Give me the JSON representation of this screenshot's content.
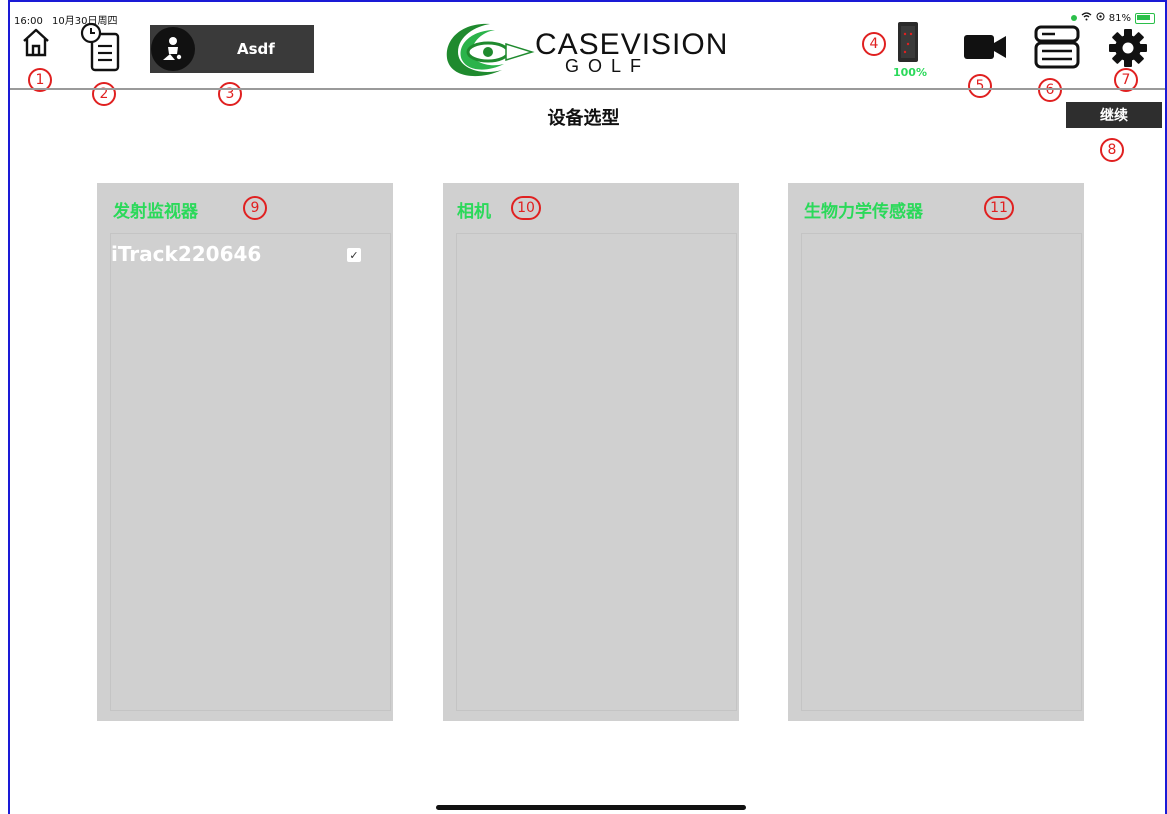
{
  "status_bar": {
    "time": "16:00",
    "date": "10月30日周四",
    "battery_percent": "81%"
  },
  "toolbar": {
    "user_name": "Asdf",
    "logo_main": "CASEVISION",
    "logo_sub": "GOLF",
    "device_battery": "100%",
    "continue_label": "继续"
  },
  "page": {
    "title": "设备选型"
  },
  "panels": [
    {
      "title": "发射监视器",
      "devices": [
        {
          "name": "iTrack220646",
          "checked": true
        }
      ]
    },
    {
      "title": "相机",
      "devices": []
    },
    {
      "title": "生物力学传感器",
      "devices": []
    }
  ],
  "annotations": [
    "1",
    "2",
    "3",
    "4",
    "5",
    "6",
    "7",
    "8",
    "9",
    "10",
    "11"
  ],
  "colors": {
    "accent_green": "#2bd95a",
    "annotation_red": "#e02020",
    "panel_gray": "#d0d0d0",
    "dark_button": "#2e2e2e"
  },
  "icons": {
    "home": "home-icon",
    "history": "history-clipboard-icon",
    "avatar": "user-avatar-icon",
    "device": "launch-monitor-device-icon",
    "camera": "video-camera-icon",
    "sensor": "sensor-stack-icon",
    "settings": "gear-icon"
  }
}
